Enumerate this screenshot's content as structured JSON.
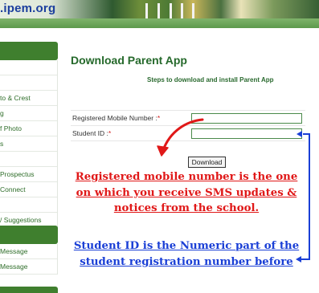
{
  "header": {
    "site_name": ".ipem.org"
  },
  "sidebar": {
    "menu_items": [
      {
        "label": ""
      },
      {
        "label": ""
      },
      {
        "label": "to & Crest"
      },
      {
        "label": "g"
      },
      {
        "label": "f Photo"
      },
      {
        "label": "s"
      },
      {
        "label": ""
      },
      {
        "label": "Prospectus"
      },
      {
        "label": "Connect"
      },
      {
        "label": ""
      },
      {
        "label": "/ Suggestions"
      }
    ],
    "menu_items_2": [
      {
        "label": "Message"
      },
      {
        "label": "Message"
      }
    ]
  },
  "main": {
    "title": "Download Parent App",
    "subtitle": "Steps to download and install Parent App",
    "form": {
      "mobile_label": "Registered Mobile Number :",
      "student_id_label": "Student ID :",
      "required_mark": "*",
      "mobile_value": "",
      "student_id_value": "",
      "download_label": "Download"
    },
    "note_red": "Registered mobile number is the one on which you receive SMS updates & notices from the school.",
    "note_blue": "Student ID is the Numeric part of the student registration number before"
  },
  "colors": {
    "brand_green": "#3f7f2e",
    "title_green": "#25692b",
    "annotation_red": "#e01818",
    "annotation_blue": "#1a3fd6"
  }
}
